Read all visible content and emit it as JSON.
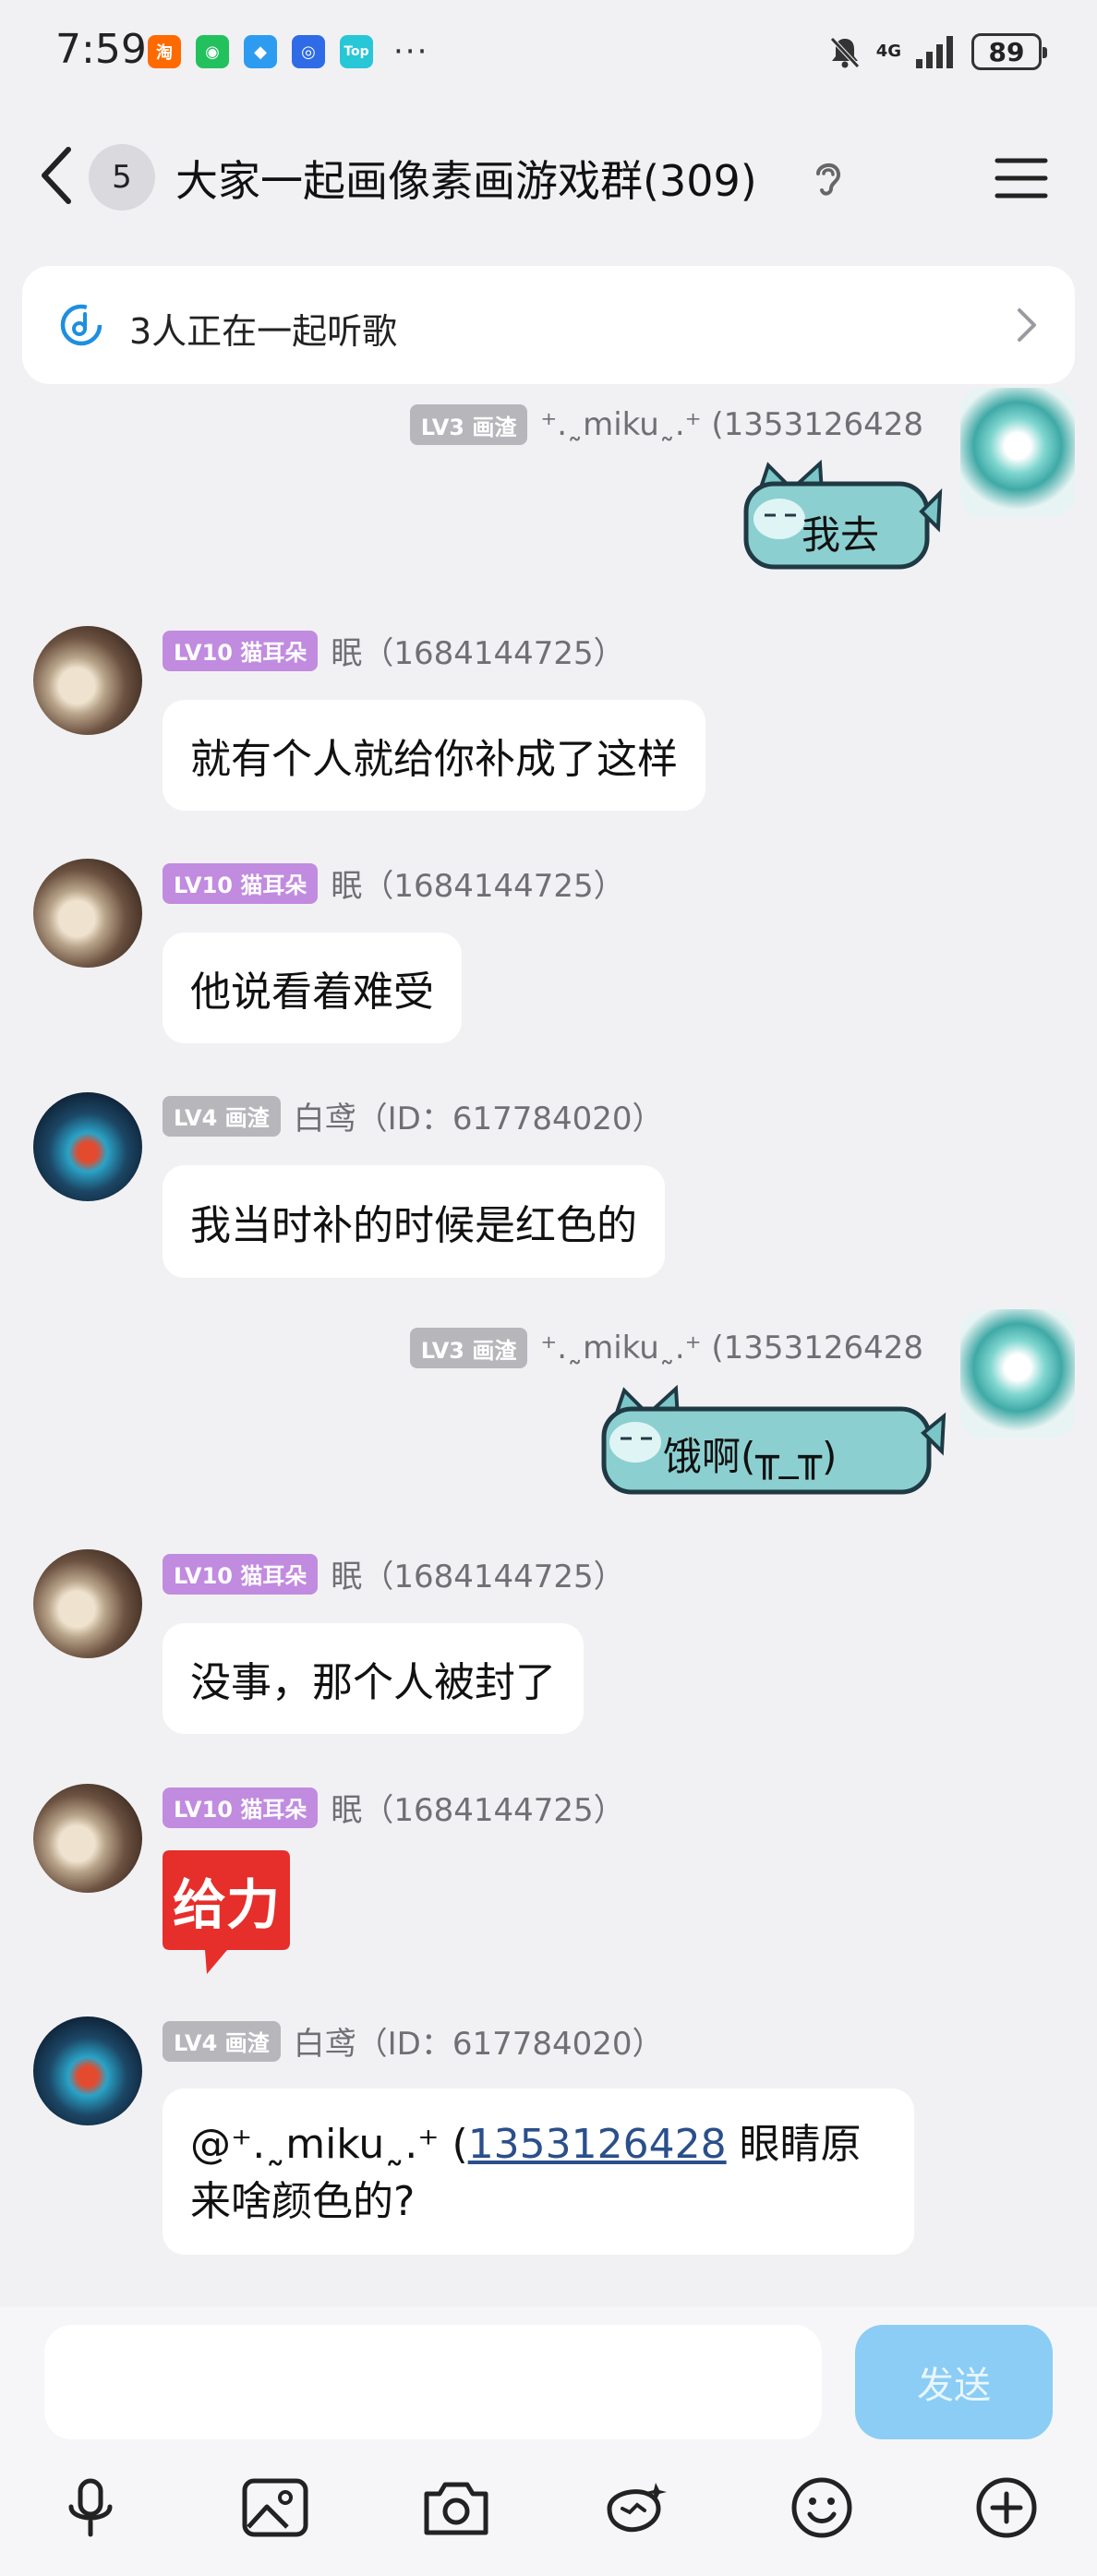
{
  "status_bar": {
    "time": "7:59",
    "apps": [
      {
        "icon": "taobao-icon",
        "glyph": "淘",
        "color": "#ff6a00"
      },
      {
        "icon": "wechat-icon",
        "glyph": "◉",
        "color": "#22c15e"
      },
      {
        "icon": "browser-icon",
        "glyph": "◆",
        "color": "#2d9cf0"
      },
      {
        "icon": "qq-icon",
        "glyph": "◎",
        "color": "#2f6be6"
      },
      {
        "icon": "top-icon",
        "glyph": "Top",
        "color": "#27c7d8"
      }
    ],
    "more": "···",
    "network": "4G",
    "battery": "89"
  },
  "header": {
    "unread_count": "5",
    "title": "大家一起画像素画游戏群(309)"
  },
  "banner": {
    "text": "3人正在一起听歌"
  },
  "messages": [
    {
      "side": "right",
      "level": "LV3 画渣",
      "nickname": "⁺.˷miku˷.⁺ (1353126428",
      "type": "sticker",
      "text": "我去"
    },
    {
      "side": "left",
      "level": "LV10 猫耳朵",
      "nickname": "眠（1684144725）",
      "type": "text",
      "text": "就有个人就给你补成了这样"
    },
    {
      "side": "left",
      "level": "LV10 猫耳朵",
      "nickname": "眠（1684144725）",
      "type": "text",
      "text": "他说看着难受"
    },
    {
      "side": "left",
      "level": "LV4 画渣",
      "nickname": "白鸢（ID：617784020）",
      "type": "text",
      "text": "我当时补的时候是红色的"
    },
    {
      "side": "right",
      "level": "LV3 画渣",
      "nickname": "⁺.˷miku˷.⁺ (1353126428",
      "type": "sticker",
      "text": "饿啊(╥_╥)"
    },
    {
      "side": "left",
      "level": "LV10 猫耳朵",
      "nickname": "眠（1684144725）",
      "type": "text",
      "text": "没事，那个人被封了"
    },
    {
      "side": "left",
      "level": "LV10 猫耳朵",
      "nickname": "眠（1684144725）",
      "type": "emoji",
      "text": "给力"
    },
    {
      "side": "left",
      "level": "LV4 画渣",
      "nickname": "白鸢（ID：617784020）",
      "type": "mention",
      "mention_prefix": "@⁺.˷miku˷.⁺ (",
      "mention_link": "1353126428",
      "text_after": " 眼睛原来啥颜色的?"
    }
  ],
  "input": {
    "placeholder": "",
    "send_label": "发送"
  },
  "toolbar": [
    "mic-icon",
    "image-icon",
    "camera-icon",
    "doodle-icon",
    "emoji-icon",
    "plus-icon"
  ]
}
